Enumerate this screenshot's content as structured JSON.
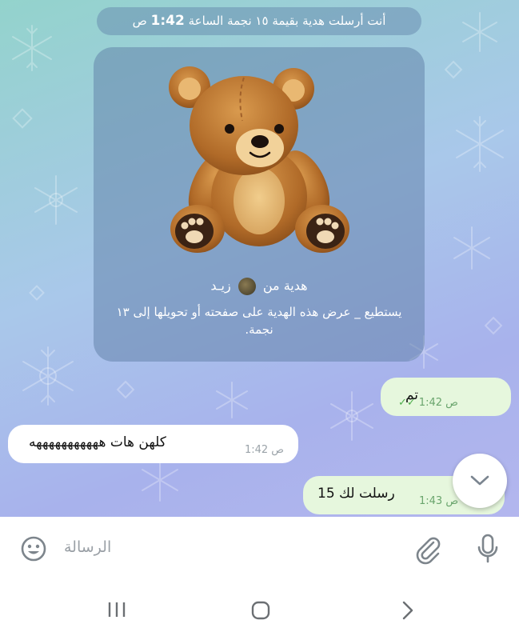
{
  "service_message": {
    "text": "أنت أرسلت هدية بقيمة ١٥ نجمة الساعة",
    "time": "1:42",
    "period": "ص"
  },
  "gift": {
    "icon": "teddy-bear",
    "from_label": "هدية من",
    "sender_name": "زيـد",
    "description": "يستطيع _ عرض هذه الهدية على صفحته أو تحويلها إلى ١٣ نجمة."
  },
  "messages": [
    {
      "direction": "out",
      "text": "تم",
      "time": "1:42 ص",
      "status": "read"
    },
    {
      "direction": "in",
      "text": "كلهن هات  هههههههههههه",
      "time": "1:42 ص"
    },
    {
      "direction": "out",
      "text": "رسلت لك 15",
      "time": "1:43 ص"
    }
  ],
  "input": {
    "placeholder": "الرسالة"
  },
  "icons": {
    "emoji": "smile-icon",
    "attach": "paperclip-icon",
    "mic": "microphone-icon",
    "scroll": "chevron-down-icon"
  },
  "colors": {
    "outgoing_bubble": "#e6f7dd",
    "incoming_bubble": "#ffffff",
    "read_ticks": "#4fae4e"
  }
}
